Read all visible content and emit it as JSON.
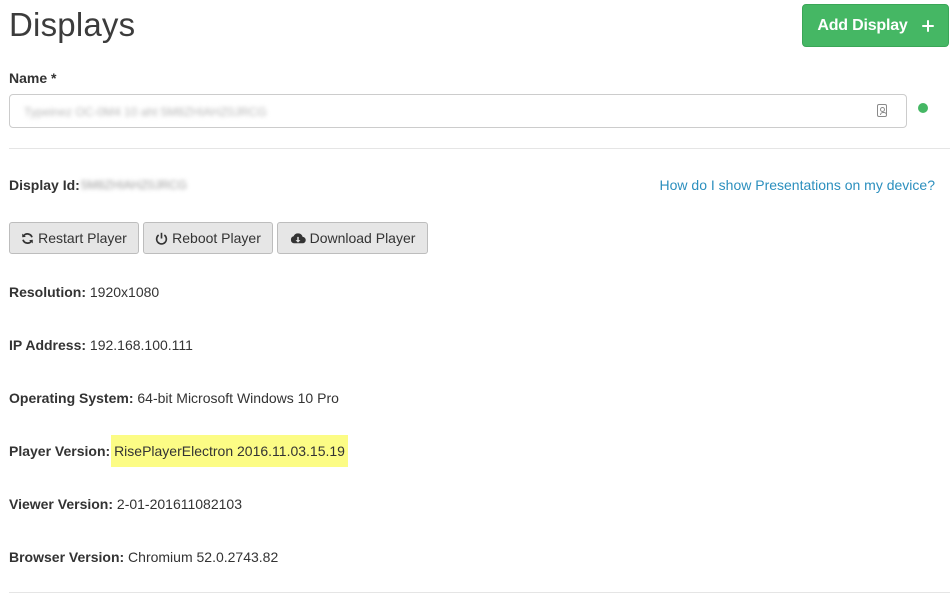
{
  "header": {
    "title": "Displays",
    "add_display_label": "Add Display"
  },
  "name_field": {
    "label": "Name *",
    "value": "Typeinez OC-0M4 10 aht 5M8ZHIAHZ0JRCG"
  },
  "display_id": {
    "label": "Display Id:",
    "value": "5M8ZHIAHZ0JRCG"
  },
  "help_link": "How do I show Presentations on my device?",
  "actions": {
    "restart_label": "Restart Player",
    "reboot_label": "Reboot Player",
    "download_label": "Download Player"
  },
  "info": {
    "resolution": {
      "label": "Resolution:",
      "value": "1920x1080"
    },
    "ip_address": {
      "label": "IP Address:",
      "value": "192.168.100.111"
    },
    "operating_system": {
      "label": "Operating System:",
      "value": "64-bit Microsoft Windows 10 Pro"
    },
    "player_version": {
      "label": "Player Version:",
      "value": "RisePlayerElectron 2016.11.03.15.19"
    },
    "viewer_version": {
      "label": "Viewer Version:",
      "value": "2-01-201611082103"
    },
    "browser_version": {
      "label": "Browser Version:",
      "value": "Chromium 52.0.2743.82"
    }
  },
  "colors": {
    "primary_green": "#45b764",
    "status_online": "#45b764",
    "link_blue": "#2b8fbe",
    "highlight_yellow": "#fcfc85"
  },
  "icons": {
    "add": "plus-icon",
    "name_field": "contact-card-icon",
    "status": "online-status-dot",
    "restart": "refresh-icon",
    "reboot": "power-icon",
    "download": "cloud-download-icon"
  }
}
